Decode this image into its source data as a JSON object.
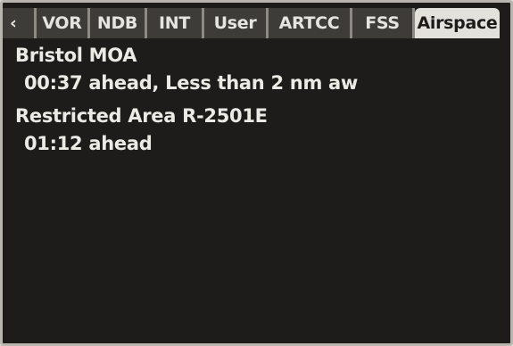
{
  "tabs": [
    {
      "label": "‹",
      "icon": "chevron-left-icon",
      "active": false
    },
    {
      "label": "VOR",
      "active": false
    },
    {
      "label": "NDB",
      "active": false
    },
    {
      "label": "INT",
      "active": false
    },
    {
      "label": "User",
      "active": false
    },
    {
      "label": "ARTCC",
      "active": false
    },
    {
      "label": "FSS",
      "active": false
    },
    {
      "label": "Airspace",
      "active": true
    }
  ],
  "airspaces": [
    {
      "name": "Bristol MOA",
      "detail": "00:37 ahead, Less than 2 nm aw"
    },
    {
      "name": "Restricted Area R-2501E",
      "detail": "01:12 ahead"
    }
  ],
  "colors": {
    "screen_background": "#1d1c1a",
    "tab_background": "#3d3c39",
    "tab_active_background": "#e3e1dc",
    "text": "#eceae5"
  }
}
